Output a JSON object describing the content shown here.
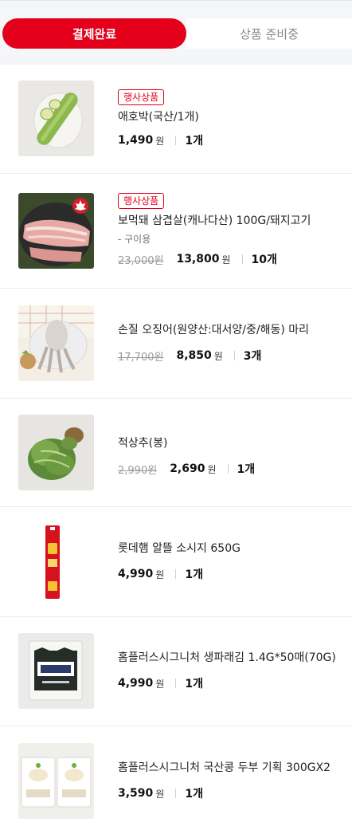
{
  "tabs": {
    "active": "결제완료",
    "inactive": "상품 준비중"
  },
  "items": [
    {
      "image": "zucchini",
      "badge": "행사상품",
      "name": "애호박(국산/1개)",
      "sub": "",
      "original_price": "",
      "price": "1,490",
      "won": "원",
      "qty": "1개"
    },
    {
      "image": "pork-belly",
      "badge": "행사상품",
      "name": "보먹돼 삼겹살(캐나다산) 100G/돼지고기",
      "sub": "- 구이용",
      "original_price": "23,000원",
      "price": "13,800",
      "won": "원",
      "qty": "10개"
    },
    {
      "image": "squid",
      "badge": "",
      "name": "손질 오징어(원양산:대서양/중/해동) 마리",
      "sub": "",
      "original_price": "17,700원",
      "price": "8,850",
      "won": "원",
      "qty": "3개"
    },
    {
      "image": "red-lettuce",
      "badge": "",
      "name": "적상추(봉)",
      "sub": "",
      "original_price": "2,990원",
      "price": "2,690",
      "won": "원",
      "qty": "1개"
    },
    {
      "image": "sausage",
      "badge": "",
      "name": "롯데햄 알뜰 소시지 650G",
      "sub": "",
      "original_price": "",
      "price": "4,990",
      "won": "원",
      "qty": "1개"
    },
    {
      "image": "seaweed",
      "badge": "",
      "name": "홈플러스시그니처 생파래김 1.4G*50매(70G)",
      "sub": "",
      "original_price": "",
      "price": "4,990",
      "won": "원",
      "qty": "1개"
    },
    {
      "image": "tofu",
      "badge": "",
      "name": "홈플러스시그니처 국산콩 두부 기획 300GX2",
      "sub": "",
      "original_price": "",
      "price": "3,590",
      "won": "원",
      "qty": "1개"
    }
  ],
  "colors": {
    "accent": "#e4001b"
  }
}
